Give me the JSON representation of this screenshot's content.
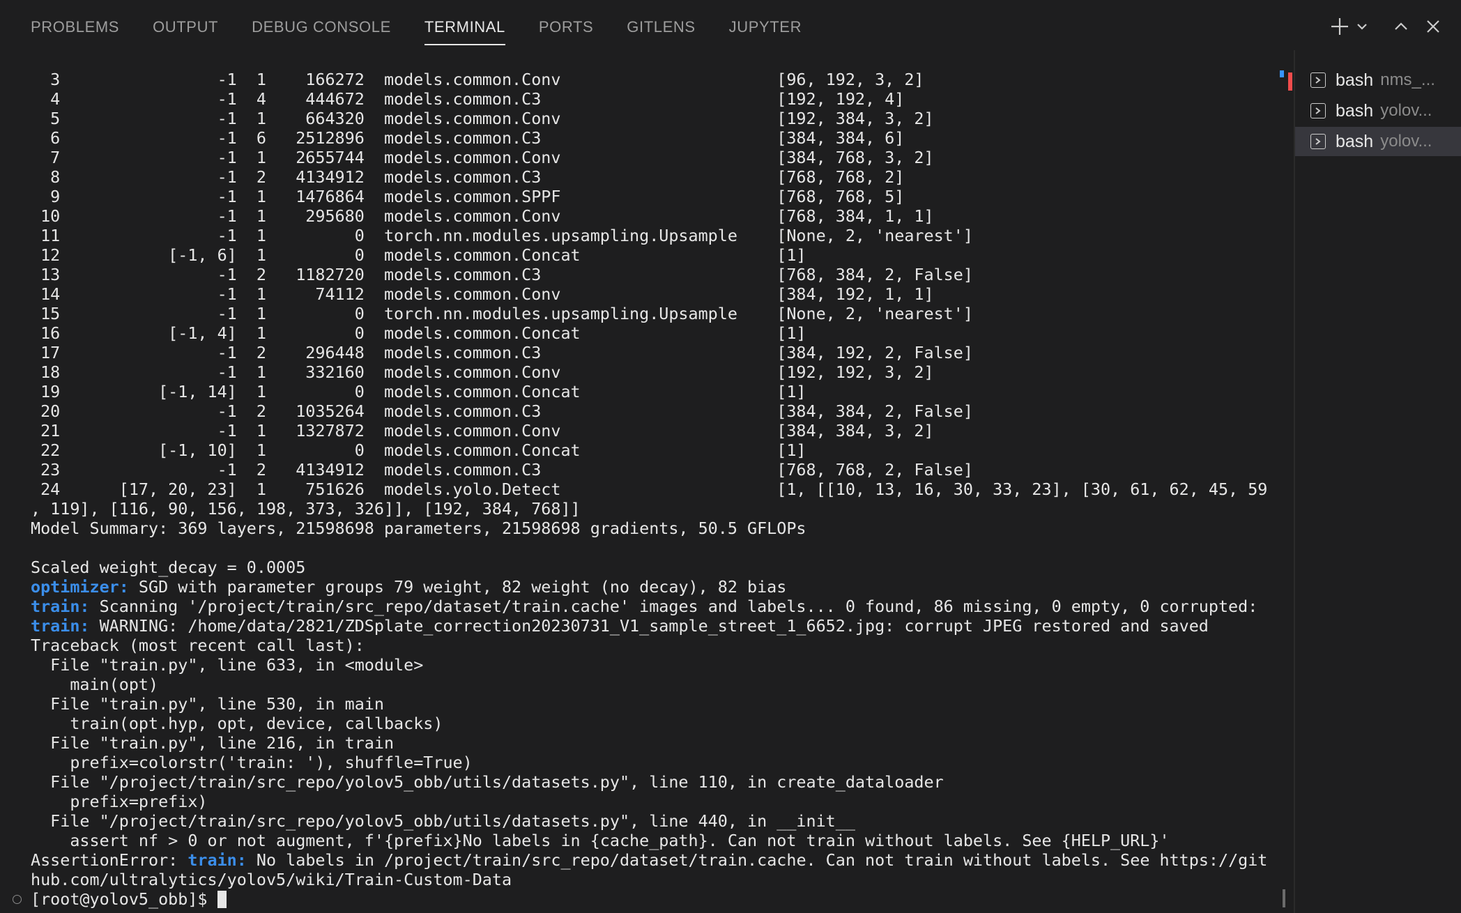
{
  "panel": {
    "tabs": [
      "PROBLEMS",
      "OUTPUT",
      "DEBUG CONSOLE",
      "TERMINAL",
      "PORTS",
      "GITLENS",
      "JUPYTER"
    ],
    "active_tab": "TERMINAL"
  },
  "terminal": {
    "lines": [
      "  3                -1  1    166272  models.common.Conv                      [96, 192, 3, 2]",
      "  4                -1  4    444672  models.common.C3                        [192, 192, 4]",
      "  5                -1  1    664320  models.common.Conv                      [192, 384, 3, 2]",
      "  6                -1  6   2512896  models.common.C3                        [384, 384, 6]",
      "  7                -1  1   2655744  models.common.Conv                      [384, 768, 3, 2]",
      "  8                -1  2   4134912  models.common.C3                        [768, 768, 2]",
      "  9                -1  1   1476864  models.common.SPPF                      [768, 768, 5]",
      " 10                -1  1    295680  models.common.Conv                      [768, 384, 1, 1]",
      " 11                -1  1         0  torch.nn.modules.upsampling.Upsample    [None, 2, 'nearest']",
      " 12           [-1, 6]  1         0  models.common.Concat                    [1]",
      " 13                -1  2   1182720  models.common.C3                        [768, 384, 2, False]",
      " 14                -1  1     74112  models.common.Conv                      [384, 192, 1, 1]",
      " 15                -1  1         0  torch.nn.modules.upsampling.Upsample    [None, 2, 'nearest']",
      " 16           [-1, 4]  1         0  models.common.Concat                    [1]",
      " 17                -1  2    296448  models.common.C3                        [384, 192, 2, False]",
      " 18                -1  1    332160  models.common.Conv                      [192, 192, 3, 2]",
      " 19          [-1, 14]  1         0  models.common.Concat                    [1]",
      " 20                -1  2   1035264  models.common.C3                        [384, 384, 2, False]",
      " 21                -1  1   1327872  models.common.Conv                      [384, 384, 3, 2]",
      " 22          [-1, 10]  1         0  models.common.Concat                    [1]",
      " 23                -1  2   4134912  models.common.C3                        [768, 768, 2, False]",
      " 24      [17, 20, 23]  1    751626  models.yolo.Detect                      [1, [[10, 13, 16, 30, 33, 23], [30, 61, 62, 45, 59",
      ", 119], [116, 90, 156, 198, 373, 326]], [192, 384, 768]]",
      "Model Summary: 369 layers, 21598698 parameters, 21598698 gradients, 50.5 GFLOPs",
      "",
      "Scaled weight_decay = 0.0005",
      {
        "prefix": "optimizer:",
        "text": " SGD with parameter groups 79 weight, 82 weight (no decay), 82 bias"
      },
      {
        "prefix": "train:",
        "text": " Scanning '/project/train/src_repo/dataset/train.cache' images and labels... 0 found, 86 missing, 0 empty, 0 corrupted:"
      },
      {
        "prefix": "train:",
        "text": " WARNING: /home/data/2821/ZDSplate_correction20230731_V1_sample_street_1_6652.jpg: corrupt JPEG restored and saved"
      },
      "Traceback (most recent call last):",
      "  File \"train.py\", line 633, in <module>",
      "    main(opt)",
      "  File \"train.py\", line 530, in main",
      "    train(opt.hyp, opt, device, callbacks)",
      "  File \"train.py\", line 216, in train",
      "    prefix=colorstr('train: '), shuffle=True)",
      "  File \"/project/train/src_repo/yolov5_obb/utils/datasets.py\", line 110, in create_dataloader",
      "    prefix=prefix)",
      "  File \"/project/train/src_repo/yolov5_obb/utils/datasets.py\", line 440, in __init__",
      "    assert nf > 0 or not augment, f'{prefix}No labels in {cache_path}. Can not train without labels. See {HELP_URL}'",
      {
        "before": "AssertionError: ",
        "prefix": "train:",
        "text": " No labels in /project/train/src_repo/dataset/train.cache. Can not train without labels. See https://git"
      },
      "hub.com/ultralytics/yolov5/wiki/Train-Custom-Data"
    ],
    "prompt": "[root@yolov5_obb]$ "
  },
  "terminal_list": [
    {
      "name": "bash",
      "desc": "nms_..."
    },
    {
      "name": "bash",
      "desc": "yolov..."
    },
    {
      "name": "bash",
      "desc": "yolov..."
    }
  ],
  "colors": {
    "background": "#1e1e1f",
    "highlight_blue": "#3b8eea",
    "active_item": "#37373d"
  },
  "icons": [
    "plus-icon",
    "chevron-down-icon",
    "chevron-up-icon",
    "close-icon",
    "terminal-icon"
  ]
}
